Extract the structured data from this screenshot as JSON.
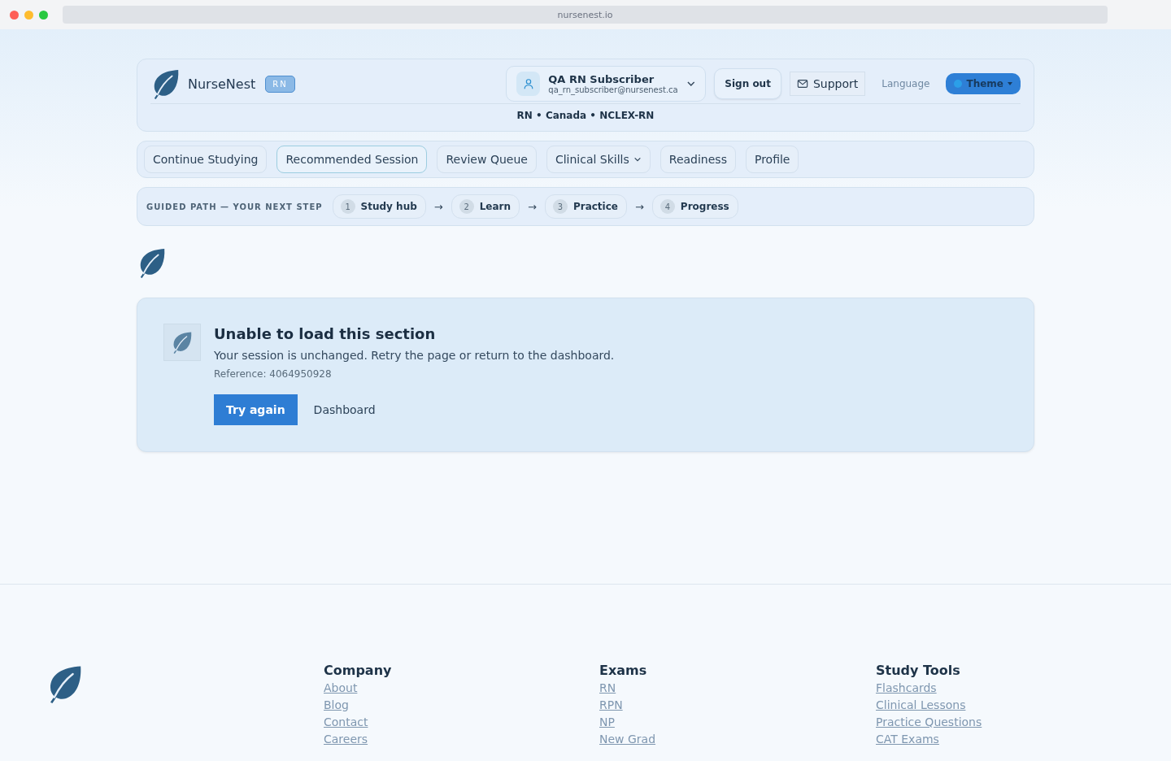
{
  "browser": {
    "url": "nursenest.io"
  },
  "header": {
    "brand": "NurseNest",
    "badge": "RN",
    "user": {
      "name": "QA RN Subscriber",
      "email": "qa_rn_subscriber@nursenest.ca"
    },
    "sign_out": "Sign out",
    "support": "Support",
    "language": "Language",
    "theme": "Theme",
    "context": "RN • Canada • NCLEX-RN"
  },
  "nav": [
    {
      "label": "Continue Studying",
      "selected": false,
      "dropdown": false
    },
    {
      "label": "Recommended Session",
      "selected": true,
      "dropdown": false
    },
    {
      "label": "Review Queue",
      "selected": false,
      "dropdown": false
    },
    {
      "label": "Clinical Skills",
      "selected": false,
      "dropdown": true
    },
    {
      "label": "Readiness",
      "selected": false,
      "dropdown": false
    },
    {
      "label": "Profile",
      "selected": false,
      "dropdown": false
    }
  ],
  "guided_path": {
    "label": "GUIDED PATH — YOUR NEXT STEP",
    "steps": [
      {
        "number": "1",
        "label": "Study hub"
      },
      {
        "arrow": "→",
        "number": "2",
        "label": "Learn"
      },
      {
        "arrow": "→",
        "number": "3",
        "label": "Practice"
      },
      {
        "arrow": "→",
        "number": "4",
        "label": "Progress"
      }
    ]
  },
  "error": {
    "title": "Unable to load this section",
    "message": "Your session is unchanged. Retry the page or return to the dashboard.",
    "reference": "Reference: 4064950928",
    "primary": "Try again",
    "secondary": "Dashboard"
  },
  "footer": {
    "columns": [
      {
        "heading": "Company",
        "links": [
          "About",
          "Blog",
          "Contact",
          "Careers"
        ]
      },
      {
        "heading": "Exams",
        "links": [
          "RN",
          "RPN",
          "NP",
          "New Grad"
        ]
      },
      {
        "heading": "Study Tools",
        "links": [
          "Flashcards",
          "Clinical Lessons",
          "Practice Questions",
          "CAT Exams"
        ]
      }
    ]
  }
}
